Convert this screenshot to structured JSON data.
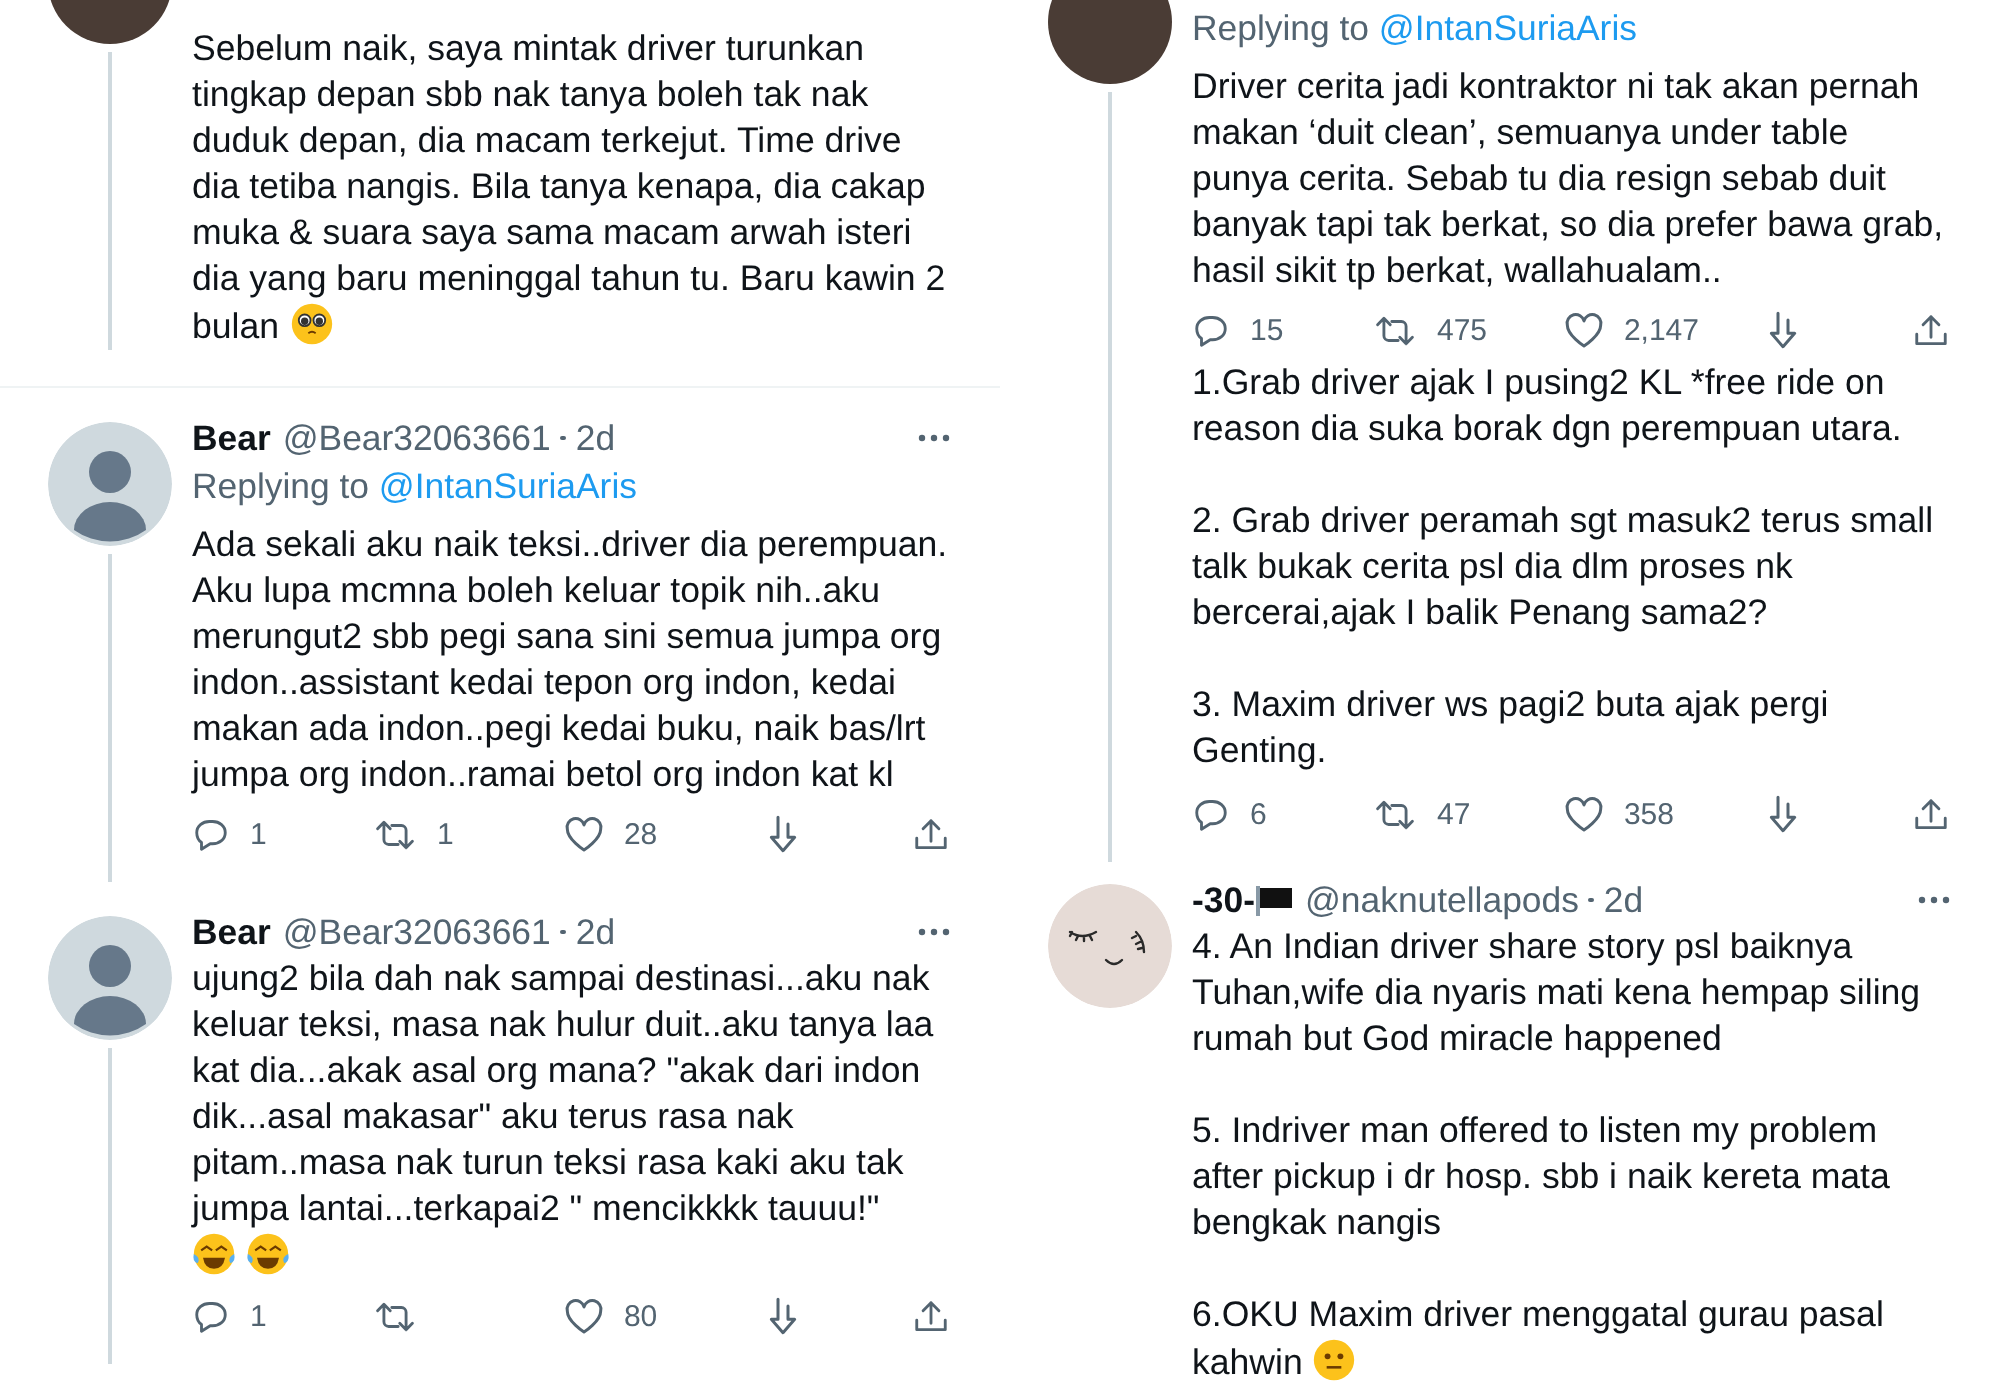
{
  "columns": [
    {
      "tweets": [
        {
          "avatar": {
            "kind": "photo"
          },
          "thread_line": true,
          "text": "Sebelum naik, saya mintak driver turunkan tingkap depan sbb nak tanya boleh tak nak duduk depan, dia macam terkejut. Time drive dia tetiba nangis. Bila tanya kenapa, dia cakap muka & suara saya sama macam arwah isteri dia yang baru meninggal tahun tu. Baru kawin 2 bulan",
          "emojis": [
            {
              "kind": "pleading"
            }
          ],
          "emoji_line": false
        },
        {
          "avatar": {
            "kind": "default"
          },
          "thread_line": true,
          "name": "Bear",
          "handle": "@Bear32063661",
          "time": "2d",
          "replying_to": {
            "label": "Replying to",
            "handle": "@IntanSuriaAris"
          },
          "text": "Ada sekali aku naik teksi..driver dia perempuan. Aku lupa mcmna boleh keluar topik nih..aku merungut2 sbb pegi sana sini semua jumpa org indon..assistant kedai tepon org indon, kedai makan ada indon..pegi kedai buku, naik bas/lrt jumpa org indon..ramai betol org indon kat kl",
          "actions": {
            "reply": "1",
            "retweet": "1",
            "like": "28"
          }
        },
        {
          "avatar": {
            "kind": "default"
          },
          "thread_line": true,
          "name": "Bear",
          "handle": "@Bear32063661",
          "time": "2d",
          "text": "ujung2 bila dah nak sampai destinasi...aku nak keluar teksi, masa nak hulur duit..aku tanya laa kat dia...akak asal org mana? \"akak dari indon dik...asal makasar\"  aku terus rasa nak pitam..masa nak turun teksi rasa kaki aku tak jumpa lantai...terkapai2 \" mencikkkk tauuu!\"",
          "emojis": [
            {
              "kind": "laughing"
            },
            {
              "kind": "laughing"
            }
          ],
          "emoji_line": true,
          "actions": {
            "reply": "1",
            "like": "80"
          }
        }
      ]
    },
    {
      "tweets": [
        {
          "avatar": {
            "kind": "photo"
          },
          "thread_line": true,
          "replying_to": {
            "label": "Replying to",
            "handle": "@IntanSuriaAris"
          },
          "text": "Driver cerita jadi kontraktor ni tak akan pernah makan ‘duit clean’, semuanya under table punya cerita. Sebab tu dia resign sebab duit banyak tapi tak berkat, so dia prefer bawa grab, hasil sikit tp berkat, wallahualam..",
          "actions": {
            "reply": "15",
            "retweet": "475",
            "like": "2,147"
          }
        },
        {
          "thread_line": true,
          "text": "1.Grab driver ajak I pusing2 KL *free ride on reason dia suka borak dgn perempuan utara.\n\n2. Grab driver peramah sgt masuk2 terus small talk bukak cerita psl dia dlm proses nk bercerai,ajak I balik Penang sama2?\n\n3. Maxim driver ws pagi2 buta ajak pergi Genting.",
          "actions": {
            "reply": "6",
            "retweet": "47",
            "like": "358"
          }
        },
        {
          "avatar": {
            "kind": "sketch"
          },
          "thread_line": false,
          "name": "-30-",
          "name_flag": true,
          "handle": "@naknutellapods",
          "time": "2d",
          "text": "4. An Indian driver share story psl baiknya Tuhan,wife dia nyaris mati kena hempap siling rumah but God miracle happened\n\n5. Indriver man offered to listen my problem after pickup i dr hosp. sbb i naik kereta mata bengkak nangis\n\n6.OKU Maxim driver menggatal gurau pasal kahwin",
          "emojis": [
            {
              "kind": "neutral"
            }
          ],
          "emoji_line": false
        }
      ]
    }
  ]
}
